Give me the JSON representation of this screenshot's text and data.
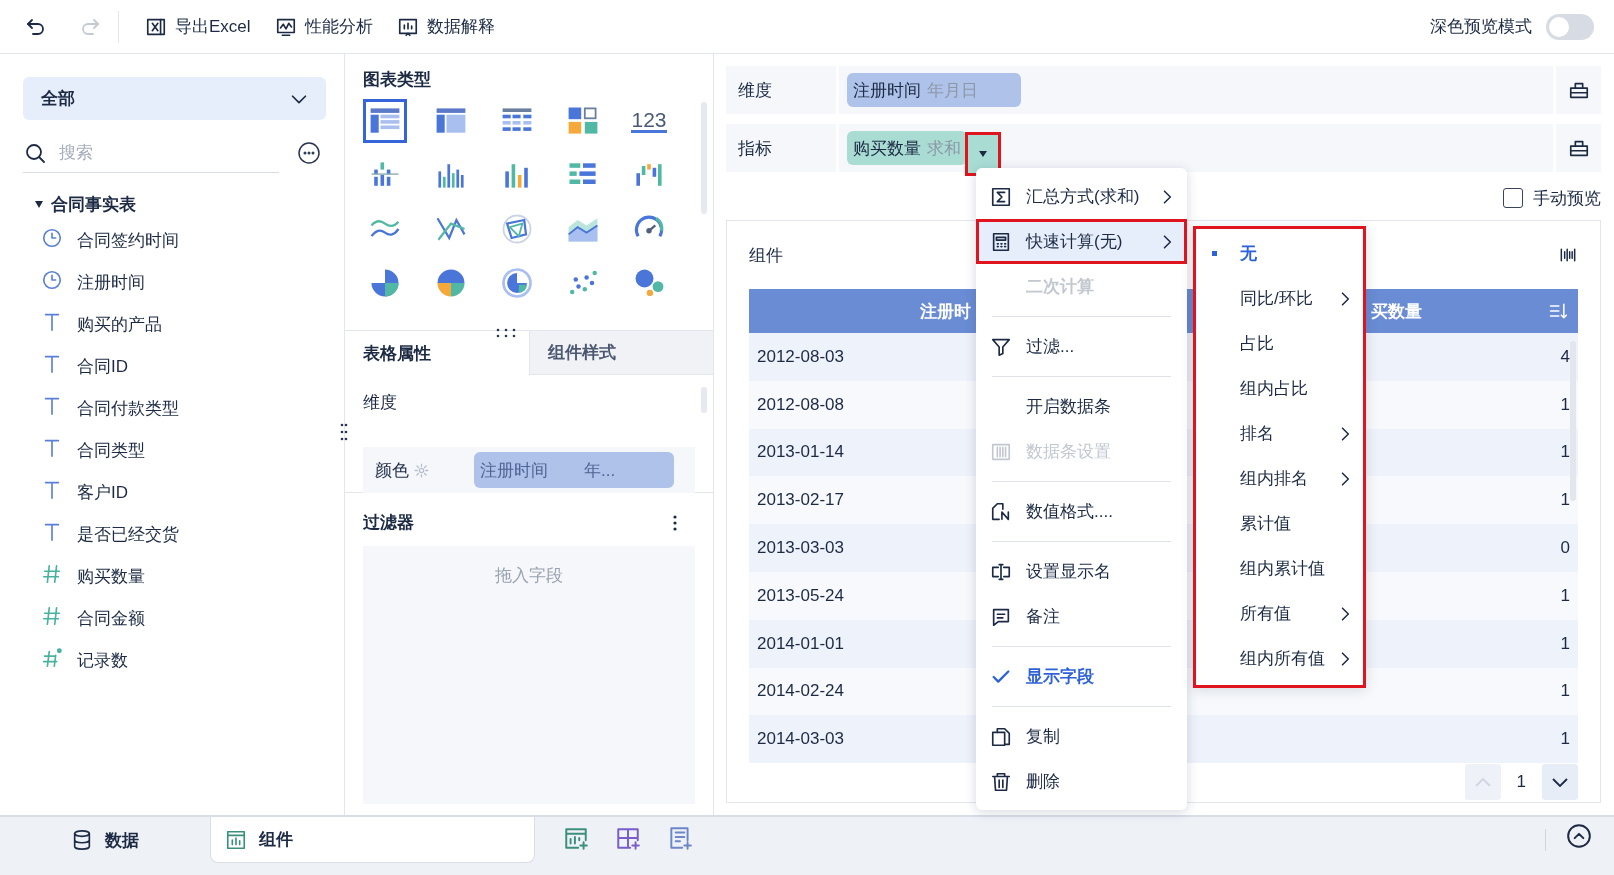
{
  "toolbar": {
    "undo": {
      "disabled": false
    },
    "redo": {
      "disabled": true
    },
    "buttons": [
      "导出Excel",
      "性能分析",
      "数据解释"
    ],
    "dark_preview": {
      "label": "深色预览模式",
      "on": false
    }
  },
  "fields_panel": {
    "scope": "全部",
    "search": {
      "placeholder": "搜索"
    },
    "tree": [
      {
        "label": "合同事实表",
        "expanded": true,
        "children": [
          {
            "label": "合同签约时间",
            "kind": "date"
          },
          {
            "label": "注册时间",
            "kind": "date"
          },
          {
            "label": "购买的产品",
            "kind": "text"
          },
          {
            "label": "合同ID",
            "kind": "text"
          },
          {
            "label": "合同付款类型",
            "kind": "text"
          },
          {
            "label": "合同类型",
            "kind": "text"
          },
          {
            "label": "客户ID",
            "kind": "text"
          },
          {
            "label": "是否已经交货",
            "kind": "text"
          },
          {
            "label": "购买数量",
            "kind": "number"
          },
          {
            "label": "合同金额",
            "kind": "number"
          },
          {
            "label": "记录数",
            "kind": "count"
          }
        ]
      }
    ]
  },
  "chart_panel": {
    "title": "图表类型",
    "chart_types": [
      {
        "selected": true
      },
      {
        "selected": false
      },
      {
        "selected": false
      },
      {
        "selected": false
      },
      {
        "selected": false,
        "label": "123"
      },
      {
        "selected": false
      },
      {
        "selected": false
      },
      {
        "selected": false
      },
      {
        "selected": false
      },
      {
        "selected": false
      },
      {
        "selected": false
      },
      {
        "selected": false
      },
      {
        "selected": false
      },
      {
        "selected": false
      },
      {
        "selected": false
      },
      {
        "selected": false
      },
      {
        "selected": false
      },
      {
        "selected": false
      },
      {
        "selected": false
      },
      {
        "selected": false
      }
    ]
  },
  "property_tabs": [
    {
      "label": "表格属性",
      "selected": true
    },
    {
      "label": "组件样式",
      "selected": false
    }
  ],
  "properties": {
    "section": "维度",
    "color_row": {
      "label": "颜色",
      "field": "注册时间",
      "suffix": "年..."
    }
  },
  "filter": {
    "title": "过滤器",
    "placeholder": "拖入字段"
  },
  "shelves": [
    {
      "label": "维度",
      "kind": "dimension",
      "field": "注册时间",
      "suffix": "年月日",
      "menu_open": false
    },
    {
      "label": "指标",
      "kind": "measure",
      "field": "购买数量",
      "suffix": "求和",
      "menu_open": true
    }
  ],
  "manual_preview": {
    "label": "手动预览",
    "checked": false
  },
  "component": {
    "title": "组件",
    "table": {
      "columns": [
        "注册时",
        "买数量"
      ],
      "rows": [
        [
          "2012-08-03",
          "4"
        ],
        [
          "2012-08-08",
          "1"
        ],
        [
          "2013-01-14",
          "1"
        ],
        [
          "2013-02-17",
          "1"
        ],
        [
          "2013-03-03",
          "0"
        ],
        [
          "2013-05-24",
          "1"
        ],
        [
          "2014-01-01",
          "1"
        ],
        [
          "2014-02-24",
          "1"
        ],
        [
          "2014-03-03",
          "1"
        ]
      ]
    },
    "page": "1"
  },
  "context_menu": {
    "items": [
      {
        "kind": "item",
        "label": "汇总方式(求和)",
        "submenu": true,
        "selected": false,
        "disabled": false,
        "checked": false
      },
      {
        "kind": "item",
        "label": "快速计算(无)",
        "submenu": true,
        "selected": true,
        "disabled": false,
        "checked": false
      },
      {
        "kind": "item",
        "label": "二次计算",
        "submenu": false,
        "selected": false,
        "disabled": true,
        "checked": false
      },
      {
        "kind": "separator"
      },
      {
        "kind": "item",
        "label": "过滤...",
        "submenu": false,
        "selected": false,
        "disabled": false,
        "checked": false
      },
      {
        "kind": "separator"
      },
      {
        "kind": "item",
        "label": "开启数据条",
        "submenu": false,
        "selected": false,
        "disabled": false,
        "checked": false
      },
      {
        "kind": "item",
        "label": "数据条设置",
        "submenu": false,
        "selected": false,
        "disabled": true,
        "checked": false
      },
      {
        "kind": "separator"
      },
      {
        "kind": "item",
        "label": "数值格式....",
        "submenu": false,
        "selected": false,
        "disabled": false,
        "checked": false
      },
      {
        "kind": "separator"
      },
      {
        "kind": "item",
        "label": "设置显示名",
        "submenu": false,
        "selected": false,
        "disabled": false,
        "checked": false
      },
      {
        "kind": "item",
        "label": "备注",
        "submenu": false,
        "selected": false,
        "disabled": false,
        "checked": false
      },
      {
        "kind": "separator"
      },
      {
        "kind": "item",
        "label": "显示字段",
        "submenu": false,
        "selected": false,
        "disabled": false,
        "checked": true
      },
      {
        "kind": "separator"
      },
      {
        "kind": "item",
        "label": "复制",
        "submenu": false,
        "selected": false,
        "disabled": false,
        "checked": false
      },
      {
        "kind": "item",
        "label": "删除",
        "submenu": false,
        "selected": false,
        "disabled": false,
        "checked": false
      }
    ]
  },
  "submenu": {
    "annotated": true,
    "items": [
      {
        "label": "无",
        "selected": true,
        "submenu": false
      },
      {
        "label": "同比/环比",
        "selected": false,
        "submenu": true
      },
      {
        "label": "占比",
        "selected": false,
        "submenu": false
      },
      {
        "label": "组内占比",
        "selected": false,
        "submenu": false
      },
      {
        "label": "排名",
        "selected": false,
        "submenu": true
      },
      {
        "label": "组内排名",
        "selected": false,
        "submenu": true
      },
      {
        "label": "累计值",
        "selected": false,
        "submenu": false
      },
      {
        "label": "组内累计值",
        "selected": false,
        "submenu": false
      },
      {
        "label": "所有值",
        "selected": false,
        "submenu": true
      },
      {
        "label": "组内所有值",
        "selected": false,
        "submenu": true
      }
    ]
  },
  "bottom_tabs": [
    {
      "label": "数据",
      "selected": false
    },
    {
      "label": "组件",
      "selected": true
    }
  ]
}
